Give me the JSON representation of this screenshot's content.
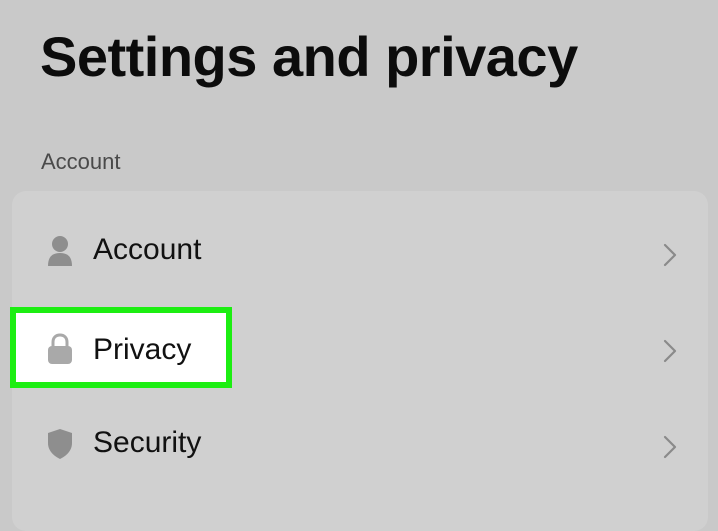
{
  "page": {
    "title": "Settings and privacy"
  },
  "section": {
    "label": "Account"
  },
  "rows": [
    {
      "label": "Account",
      "icon": "person-icon"
    },
    {
      "label": "Privacy",
      "icon": "lock-icon",
      "highlighted": true
    },
    {
      "label": "Security",
      "icon": "shield-icon"
    }
  ],
  "colors": {
    "background": "#c9c9c9",
    "card": "#d0d0d0",
    "highlight_border": "#1cee12",
    "icon": "#8e8e8e"
  }
}
